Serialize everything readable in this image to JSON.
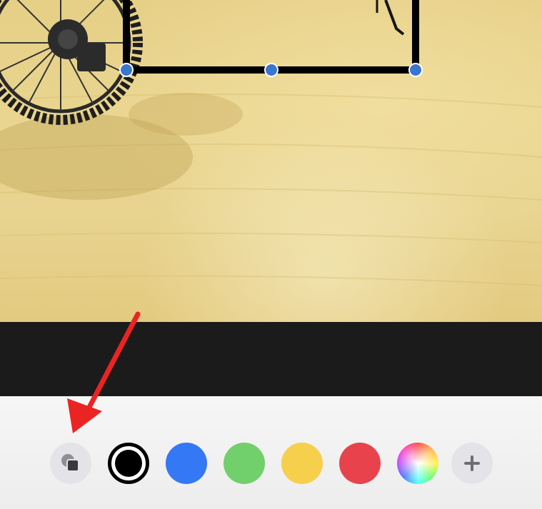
{
  "colors": {
    "blue": "#3478f6",
    "green": "#71cf6c",
    "yellow": "#f6cf4c",
    "red": "#e8434c",
    "selected": "#000000",
    "arrow": "#ec2323",
    "handle": "#3a75d0"
  },
  "toolbar": {
    "tools": [
      {
        "name": "shapes-icon",
        "selected": false
      },
      {
        "name": "color-black",
        "selected": true
      },
      {
        "name": "color-blue",
        "selected": false
      },
      {
        "name": "color-green",
        "selected": false
      },
      {
        "name": "color-yellow",
        "selected": false
      },
      {
        "name": "color-red",
        "selected": false
      },
      {
        "name": "color-wheel-icon",
        "selected": false
      },
      {
        "name": "plus-icon",
        "selected": false
      }
    ]
  }
}
